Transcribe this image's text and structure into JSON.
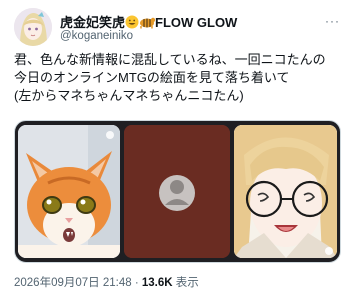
{
  "account": {
    "display_name": "虎金妃笑虎",
    "name_suffix": "FLOW GLOW",
    "handle": "@koganeiniko",
    "more_label": "···"
  },
  "tweet": {
    "lines": [
      "君、色んな新情報に混乱しているね、一回ニコたんの",
      "今日のオンラインMTGの絵面を見て落ち着いて",
      "(左からマネちゃんマネちゃんニコたん)"
    ]
  },
  "media": {
    "panels": [
      {
        "label": "orange-cat-camera"
      },
      {
        "label": "default-avatar-camera"
      },
      {
        "label": "anime-girl-camera"
      }
    ],
    "colors": {
      "cat": "#e98a3a",
      "middle": "#6b2d22",
      "hair": "#e7c98f"
    }
  },
  "meta": {
    "timestamp": "2026年09月07日 21:48",
    "separator": "·",
    "views_count": "13.6K",
    "views_label": "表示"
  }
}
